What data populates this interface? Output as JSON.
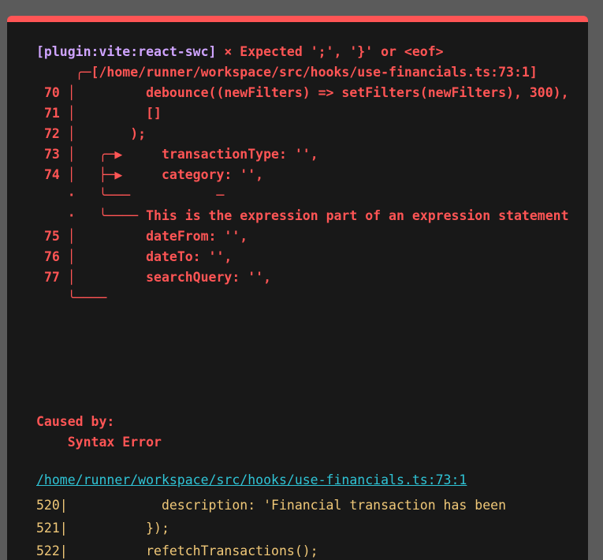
{
  "error": {
    "plugin_tag": "[plugin:vite:react-swc]",
    "message": " × Expected ';', '}' or <eof>",
    "lines": [
      "     ╭─[/home/runner/workspace/src/hooks/use-financials.ts:73:1]",
      " 70 │         debounce((newFilters) => setFilters(newFilters), 300),",
      " 71 │         []",
      " 72 │       );",
      " 73 │   ╭─▶     transactionType: '',",
      " 74 │   ├─▶     category: '',",
      "    ·   ╰───           ─",
      "    ·   ╰──── This is the expression part of an expression statement",
      " 75 │         dateFrom: '',",
      " 76 │         dateTo: '',",
      " 77 │         searchQuery: '',",
      "    ╰────"
    ]
  },
  "caused_by": {
    "label": "Caused by:",
    "detail": "    Syntax Error"
  },
  "file_link": "/home/runner/workspace/src/hooks/use-financials.ts:73:1",
  "frame_lines": [
    "520|            description: 'Financial transaction has been",
    "521|          });",
    "522|          refetchTransactions();"
  ],
  "colors": {
    "background": "#181818",
    "overlay": "#5b5b5b",
    "accent_border": "#ff5555",
    "error_text": "#ff5555",
    "plugin_text": "#cfa4ff",
    "link": "#2fc4d6",
    "frame_text": "#f0c878"
  }
}
